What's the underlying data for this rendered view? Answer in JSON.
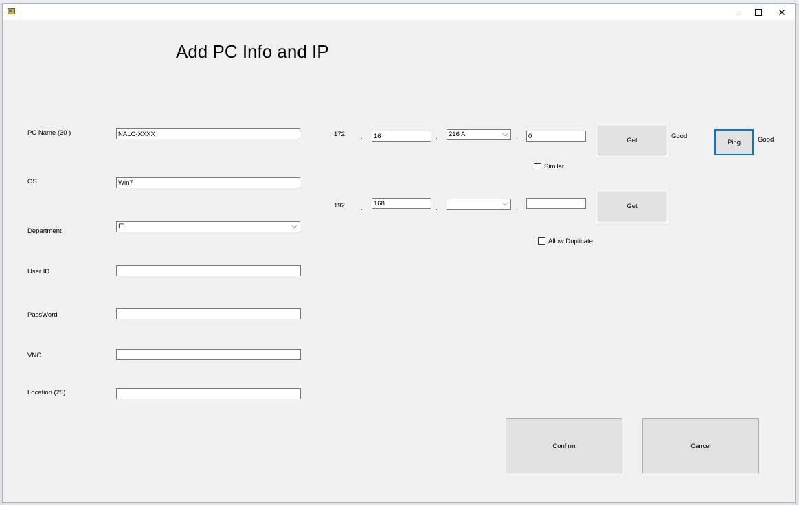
{
  "form": {
    "title": "Add PC Info and IP",
    "labels": {
      "pc_name": "PC Name (30 )",
      "os": "OS",
      "department": "Department",
      "user_id": "User ID",
      "password": "PassWord",
      "vnc": "VNC",
      "location": "Location (25)"
    },
    "values": {
      "pc_name": "NALC-XXXX",
      "os": "Win7",
      "department": "IT",
      "user_id": "",
      "password": "",
      "vnc": "",
      "location": ""
    }
  },
  "ip1": {
    "octet1": "172",
    "octet2": "16",
    "octet3": "216 A",
    "octet4": "0",
    "get_label": "Get",
    "status": "Good",
    "ping_label": "Ping",
    "ping_status": "Good",
    "similar_label": "Similar",
    "similar_checked": false
  },
  "ip2": {
    "octet1": "192",
    "octet2": "168",
    "octet3": "",
    "octet4": "",
    "get_label": "Get",
    "allow_duplicate_label": "Allow Duplicate",
    "allow_duplicate_checked": false
  },
  "separator": ".",
  "actions": {
    "confirm_label": "Confirm",
    "cancel_label": "Cancel"
  },
  "icons": {
    "app": "app-form-icon",
    "minimize": "minimize-icon",
    "maximize": "maximize-icon",
    "close": "close-icon",
    "dropdown": "chevron-down-icon"
  }
}
